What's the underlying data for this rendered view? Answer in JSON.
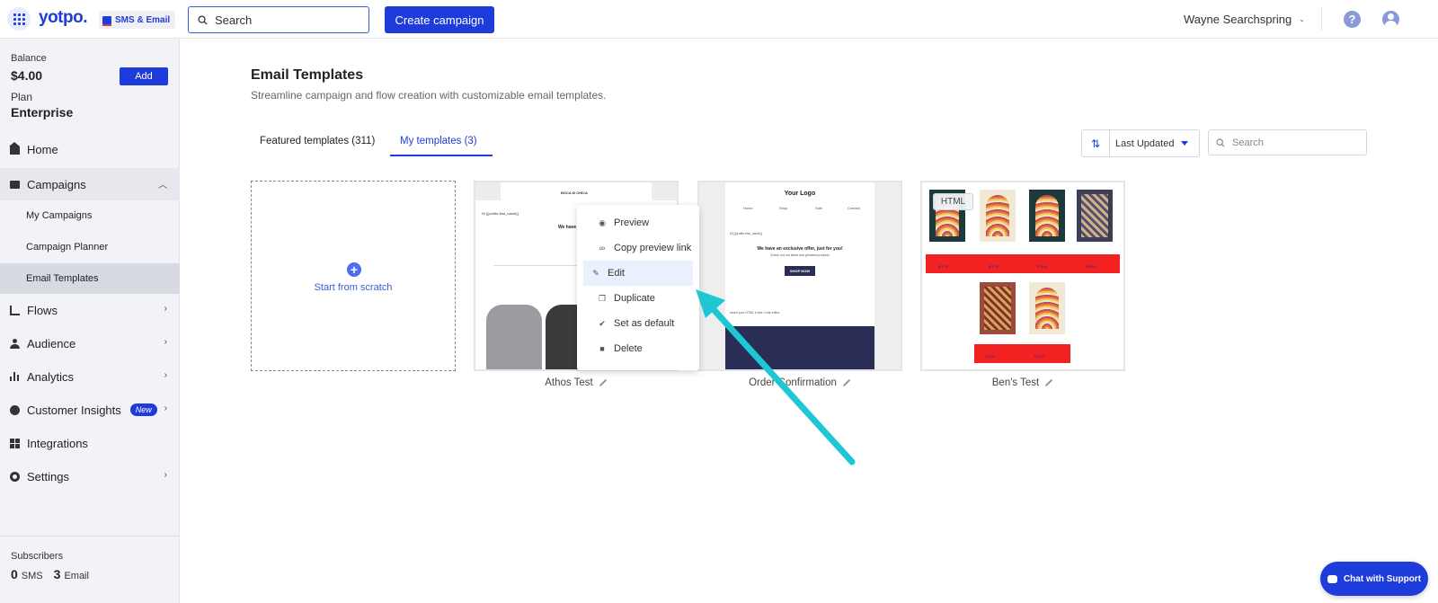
{
  "header": {
    "logo": "yotpo.",
    "product": "SMS & Email",
    "search_placeholder": "Search",
    "create_label": "Create campaign",
    "user_name": "Wayne Searchspring"
  },
  "sidebar": {
    "balance_label": "Balance",
    "balance": "$4.00",
    "add_label": "Add",
    "plan_label": "Plan",
    "plan": "Enterprise",
    "items": [
      {
        "label": "Home"
      },
      {
        "label": "Campaigns"
      },
      {
        "label": "Flows"
      },
      {
        "label": "Audience"
      },
      {
        "label": "Analytics"
      },
      {
        "label": "Customer Insights",
        "badge": "New"
      },
      {
        "label": "Integrations"
      },
      {
        "label": "Settings"
      }
    ],
    "sub_items": [
      {
        "label": "My Campaigns"
      },
      {
        "label": "Campaign Planner"
      },
      {
        "label": "Email Templates"
      }
    ],
    "subscribers_label": "Subscribers",
    "sms_count": "0",
    "sms_label": "SMS",
    "email_count": "3",
    "email_label": "Email"
  },
  "main": {
    "title": "Email Templates",
    "subtitle": "Streamline campaign and flow creation with customizable email templates.",
    "tabs": [
      {
        "label": "Featured templates (311)"
      },
      {
        "label": "My templates (3)",
        "active": true
      }
    ],
    "sort_label": "Last Updated",
    "search_placeholder": "Search",
    "scratch_label": "Start from scratch",
    "templates": [
      {
        "name": "Athos Test"
      },
      {
        "name": "Order Confirmation"
      },
      {
        "name": "Ben's Test"
      }
    ]
  },
  "thumbnails": {
    "t1": {
      "brand": "BOCA ✿ CHICA",
      "greeting": "Hi {{profile.first_name}}",
      "heading": "We have"
    },
    "t2": {
      "logo": "Your Logo",
      "nav": [
        "Home",
        "Shop",
        "Sale",
        "Contact"
      ],
      "greeting": "Hi {{profile.first_name}}",
      "offer": "We have an exclusive offer, just for you!",
      "offer_sub": "Check out our latest and greatest products",
      "shop_label": "SHOP NOW",
      "html_note": "Insert your HTML in the Code editor"
    },
    "t3": {
      "html_chip": "HTML",
      "price": "$75.00"
    }
  },
  "context_menu": {
    "items": [
      {
        "label": "Preview",
        "icon": "eye-icon"
      },
      {
        "label": "Copy preview link",
        "icon": "link-icon"
      },
      {
        "label": "Edit",
        "icon": "pencil-icon",
        "hover": true
      },
      {
        "label": "Duplicate",
        "icon": "copy-icon"
      },
      {
        "label": "Set as default",
        "icon": "check-circle-icon"
      },
      {
        "label": "Delete",
        "icon": "trash-icon"
      }
    ]
  },
  "chat": {
    "label": "Chat with Support"
  },
  "colors": {
    "brand": "#1e3cdb",
    "arrow": "#1fc7d4",
    "banner_red": "#f32222"
  }
}
